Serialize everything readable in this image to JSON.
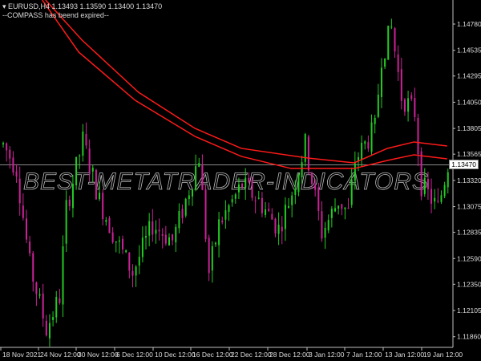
{
  "header": {
    "symbol_line": "▾ EURUSD,H4  1.13493 1.13590 1.13400 1.13470",
    "indicator_line": "--COMPASS has beend expired--"
  },
  "watermark": "BEST-METATRADER-INDICATORS",
  "current_price": "1.13470",
  "colors": {
    "bull": "#22cc22",
    "bear": "#cc2299",
    "ma": "#ff1a1a",
    "axis": "#c0c0c0",
    "bg": "#000000"
  },
  "chart_data": {
    "type": "candlestick",
    "symbol": "EURUSD",
    "timeframe": "H4",
    "y_ticks": [
      "1.14780",
      "1.14535",
      "1.14295",
      "1.14050",
      "1.13805",
      "1.13565",
      "1.13320",
      "1.13075",
      "1.12835",
      "1.12590",
      "1.12350",
      "1.12105",
      "1.11860"
    ],
    "x_ticks": [
      "18 Nov 2021",
      "24 Nov 12:00",
      "30 Nov 12:00",
      "6 Dec 12:00",
      "10 Dec 12:00",
      "16 Dec 12:00",
      "22 Dec 12:00",
      "28 Dec 12:00",
      "3 Jan 12:00",
      "7 Jan 12:00",
      "13 Jan 12:00",
      "19 Jan 12:00"
    ],
    "bar_count": 135,
    "price_path": [
      [
        0,
        1.13656
      ],
      [
        4,
        1.13431
      ],
      [
        8,
        1.12532
      ],
      [
        13,
        1.11933
      ],
      [
        17,
        1.12233
      ],
      [
        19,
        1.13057
      ],
      [
        24,
        1.13694
      ],
      [
        29,
        1.13132
      ],
      [
        33,
        1.12832
      ],
      [
        39,
        1.12457
      ],
      [
        45,
        1.12907
      ],
      [
        51,
        1.12757
      ],
      [
        55,
        1.13132
      ],
      [
        59,
        1.13544
      ],
      [
        62,
        1.12457
      ],
      [
        65,
        1.12907
      ],
      [
        72,
        1.13282
      ],
      [
        77,
        1.13132
      ],
      [
        83,
        1.12869
      ],
      [
        87,
        1.13207
      ],
      [
        91,
        1.13656
      ],
      [
        96,
        1.12832
      ],
      [
        101,
        1.13132
      ],
      [
        104,
        1.13019
      ],
      [
        106,
        1.13506
      ],
      [
        112,
        1.13806
      ],
      [
        114,
        1.1448
      ],
      [
        117,
        1.14742
      ],
      [
        120,
        1.14106
      ],
      [
        124,
        1.13956
      ],
      [
        126,
        1.13282
      ],
      [
        131,
        1.13057
      ],
      [
        134,
        1.1347
      ]
    ],
    "ma_upper": [
      [
        13,
        1.15005
      ],
      [
        24,
        1.1463
      ],
      [
        41,
        1.14143
      ],
      [
        58,
        1.13806
      ],
      [
        72,
        1.13619
      ],
      [
        92,
        1.13529
      ],
      [
        106,
        1.13484
      ],
      [
        116,
        1.13619
      ],
      [
        124,
        1.13679
      ],
      [
        134,
        1.13641
      ]
    ],
    "ma_lower": [
      [
        12,
        1.15005
      ],
      [
        23,
        1.14518
      ],
      [
        40,
        1.14068
      ],
      [
        58,
        1.13731
      ],
      [
        72,
        1.13544
      ],
      [
        87,
        1.13431
      ],
      [
        106,
        1.13431
      ],
      [
        116,
        1.13506
      ],
      [
        124,
        1.13559
      ],
      [
        134,
        1.13521
      ]
    ]
  }
}
